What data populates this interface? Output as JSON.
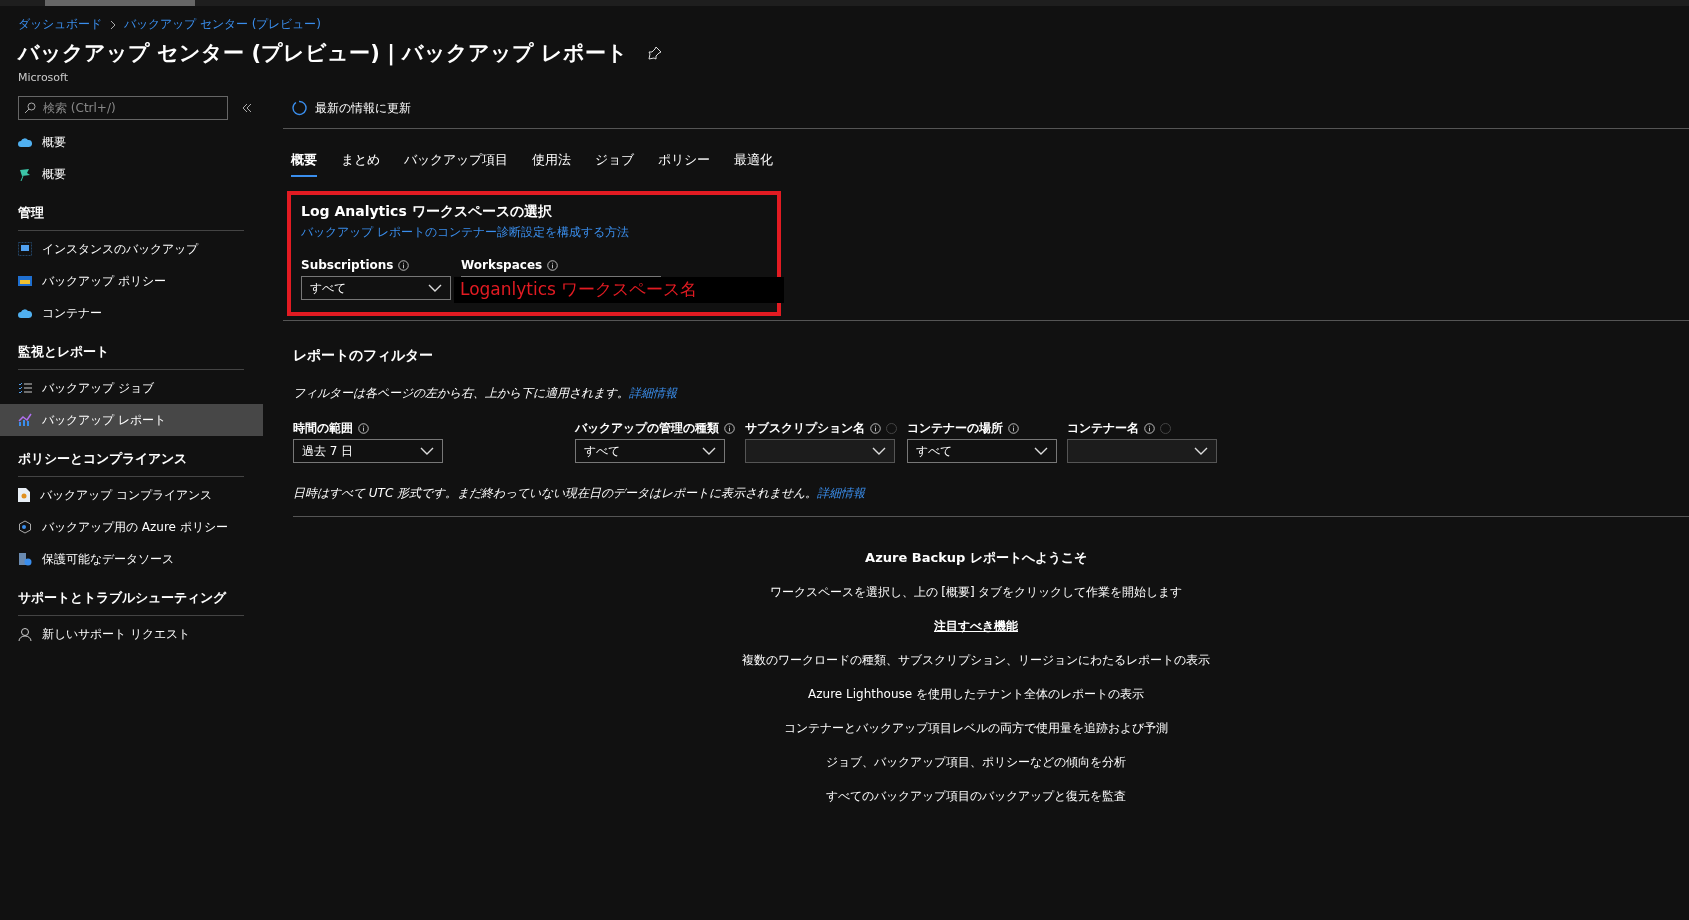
{
  "breadcrumb": [
    "ダッシュボード",
    "バックアップ センター (プレビュー)"
  ],
  "title": "バックアップ センター (プレビュー) | バックアップ レポート",
  "subtitle": "Microsoft",
  "sidebar": {
    "search": {
      "placeholder": "検索 (Ctrl+/)"
    },
    "sections": [
      {
        "items": [
          {
            "label": "概要",
            "selected": false
          },
          {
            "label": "概要",
            "selected": false
          }
        ]
      },
      {
        "heading": "管理",
        "items": [
          {
            "label": "インスタンスのバックアップ",
            "selected": false
          },
          {
            "label": "バックアップ ポリシー",
            "selected": false
          },
          {
            "label": "コンテナー",
            "selected": false
          }
        ]
      },
      {
        "heading": "監視とレポート",
        "items": [
          {
            "label": "バックアップ ジョブ",
            "selected": false
          },
          {
            "label": "バックアップ レポート",
            "selected": true
          }
        ]
      },
      {
        "heading": "ポリシーとコンプライアンス",
        "items": [
          {
            "label": "バックアップ コンプライアンス",
            "selected": false
          },
          {
            "label": "バックアップ用の Azure ポリシー",
            "selected": false
          },
          {
            "label": "保護可能なデータソース",
            "selected": false
          }
        ]
      },
      {
        "heading": "サポートとトラブルシューティング",
        "items": [
          {
            "label": "新しいサポート リクエスト",
            "selected": false
          }
        ]
      }
    ]
  },
  "toolbar": {
    "refresh": "最新の情報に更新"
  },
  "tabs": [
    {
      "label": "概要",
      "selected": true
    },
    {
      "label": "まとめ",
      "selected": false
    },
    {
      "label": "バックアップ項目",
      "selected": false
    },
    {
      "label": "使用法",
      "selected": false
    },
    {
      "label": "ジョブ",
      "selected": false
    },
    {
      "label": "ポリシー",
      "selected": false
    },
    {
      "label": "最適化",
      "selected": false
    }
  ],
  "workspace": {
    "heading": "Log Analytics ワークスペースの選択",
    "link": "バックアップ レポートのコンテナー診断設定を構成する方法",
    "subscriptions": {
      "label": "Subscriptions",
      "value": "すべて"
    },
    "workspaces": {
      "label": "Workspaces"
    },
    "annotation": "Loganlytics ワークスペース名"
  },
  "filters": {
    "heading": "レポートのフィルター",
    "note": "フィルターは各ページの左から右、上から下に適用されます。",
    "note_link": "詳細情報",
    "fields": [
      {
        "label": "時間の範囲",
        "value": "過去 7 日",
        "loading": false,
        "disabled": false
      },
      {
        "label": "バックアップの管理の種類",
        "value": "すべて",
        "loading": false,
        "disabled": false
      },
      {
        "label": "サブスクリプション名",
        "loading": true,
        "disabled": true
      },
      {
        "label": "コンテナーの場所",
        "value": "すべて",
        "loading": false,
        "disabled": false
      },
      {
        "label": "コンテナー名",
        "loading": true,
        "disabled": true
      }
    ],
    "footnote": "日時はすべて UTC 形式です。まだ終わっていない現在日のデータはレポートに表示されません。",
    "footnote_link": "詳細情報"
  },
  "welcome": {
    "heading": "Azure Backup レポートへようこそ",
    "instruction": "ワークスペースを選択し、上の [概要] タブをクリックして作業を開始します",
    "features_heading": "注目すべき機能",
    "features": [
      "複数のワークロードの種類、サブスクリプション、リージョンにわたるレポートの表示",
      "Azure Lighthouse を使用したテナント全体のレポートの表示",
      "コンテナーとバックアップ項目レベルの両方で使用量を追跡および予測",
      "ジョブ、バックアップ項目、ポリシーなどの傾向を分析",
      "すべてのバックアップ項目のバックアップと復元を監査"
    ]
  }
}
